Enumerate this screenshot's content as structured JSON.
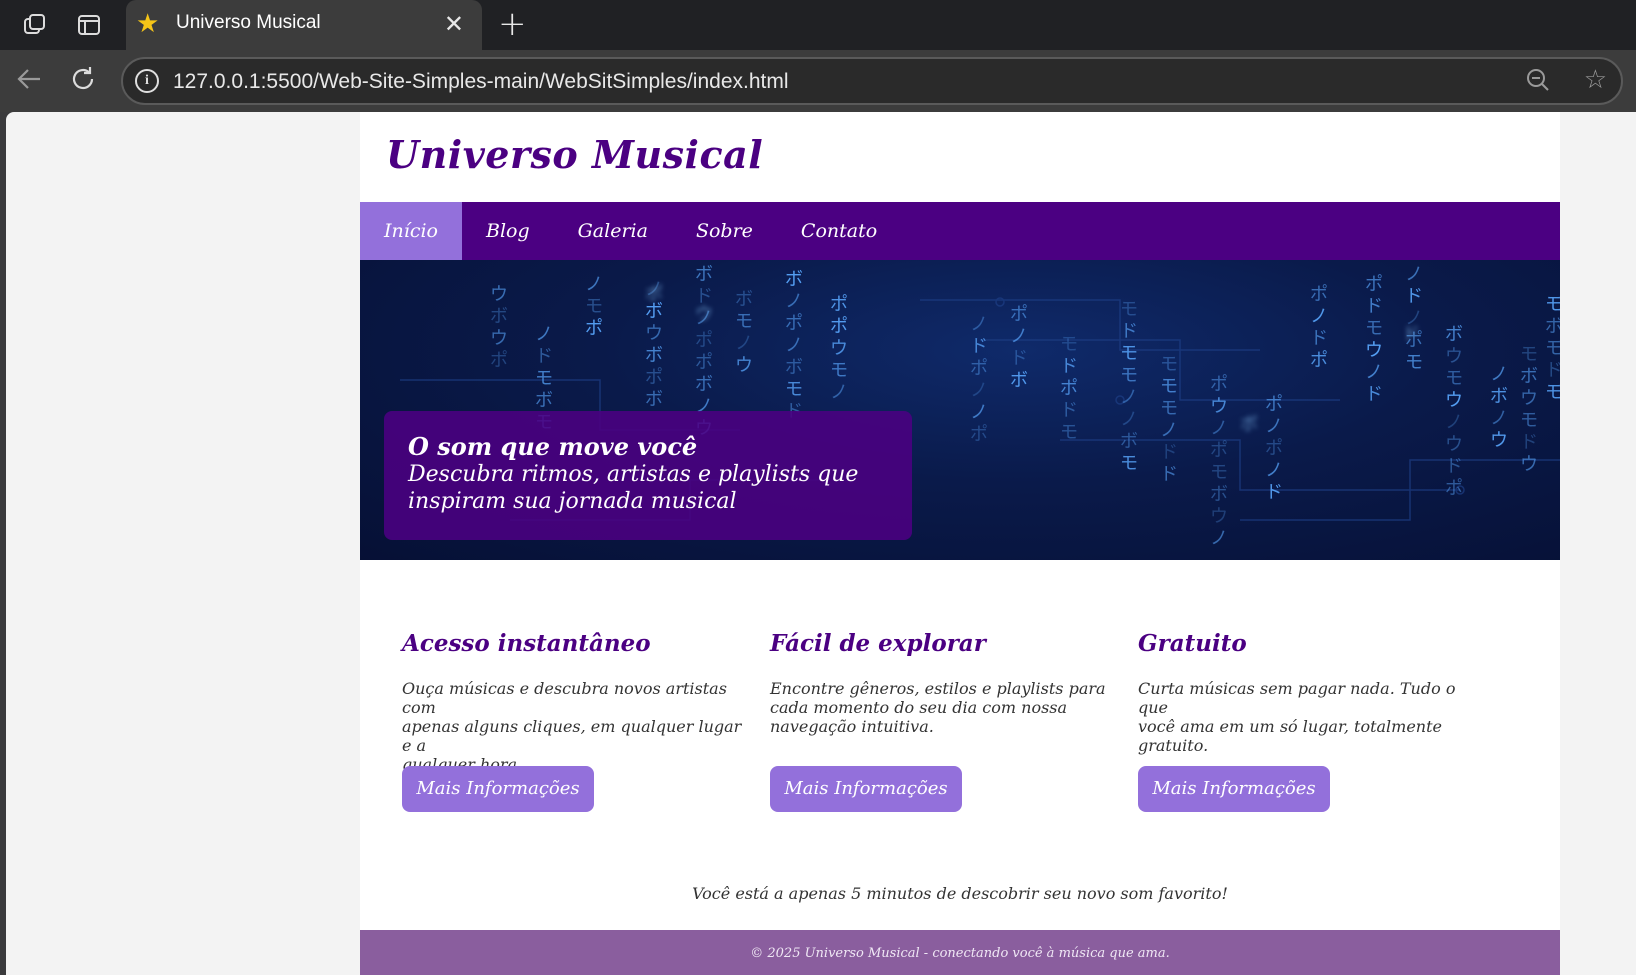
{
  "browser": {
    "tab_title": "Universo Musical",
    "url": "127.0.0.1:5500/Web-Site-Simples-main/WebSitSimples/index.html",
    "icons": [
      "workspaces-icon",
      "tab-actions-icon",
      "star-icon",
      "close-icon",
      "new-tab-icon",
      "back-icon",
      "refresh-icon",
      "info-icon",
      "zoom-out-icon",
      "favorite-icon"
    ]
  },
  "site": {
    "title": "Universo Musical",
    "nav": [
      {
        "label": "Início",
        "active": true
      },
      {
        "label": "Blog"
      },
      {
        "label": "Galeria"
      },
      {
        "label": "Sobre"
      },
      {
        "label": "Contato"
      }
    ],
    "hero": {
      "title": "O som que move você",
      "subtitle_line1": "Descubra ritmos, artistas e playlists que",
      "subtitle_line2": "inspiram sua jornada musical"
    },
    "features": [
      {
        "title": "Acesso instantâneo",
        "line1": "Ouça músicas e descubra novos artistas com",
        "line2": "apenas alguns cliques, em qualquer lugar e a",
        "line3": "qualquer hora.",
        "button": "Mais Informações"
      },
      {
        "title": "Fácil de explorar",
        "line1": "Encontre gêneros, estilos e playlists para",
        "line2": "cada momento do seu dia com nossa",
        "line3": "navegação intuitiva.",
        "button": "Mais Informações"
      },
      {
        "title": "Gratuito",
        "line1": "Curta músicas sem pagar nada. Tudo o que",
        "line2": "você ama em um só lugar, totalmente",
        "line3": "gratuito.",
        "button": "Mais Informações"
      }
    ],
    "tagline": "Você está a apenas 5 minutos de descobrir seu novo som favorito!",
    "footer": "© 2025 Universo Musical - conectando você à música que ama."
  },
  "colors": {
    "brand": "#4b0082",
    "accent": "#9370db",
    "footer": "#8a5e9e"
  }
}
